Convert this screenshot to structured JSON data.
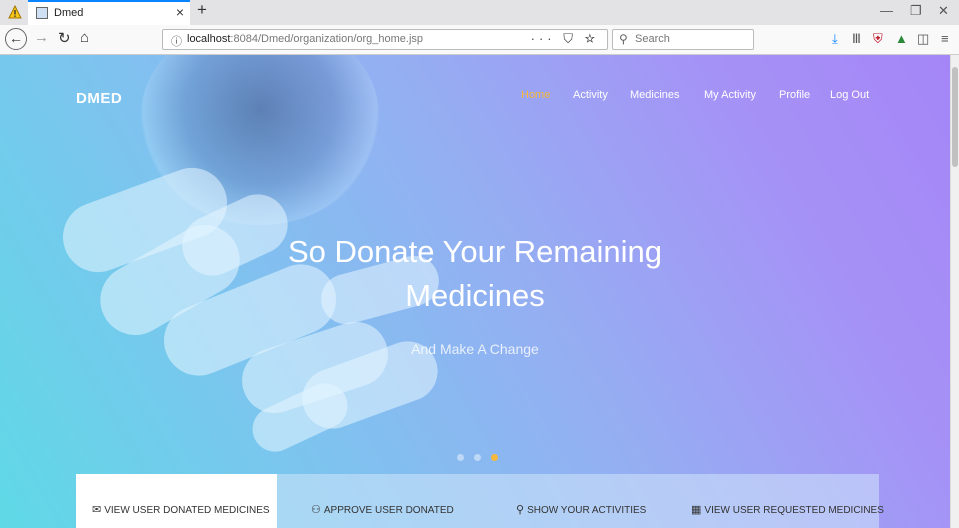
{
  "browser": {
    "tab_title": "Dmed",
    "url_prefix": "localhost",
    "url_rest": ":8084/Dmed/organization/org_home.jsp",
    "search_placeholder": "Search",
    "url_actions": "··· ⛉ ☆"
  },
  "site": {
    "logo": "DMED",
    "menu": [
      "Home",
      "Activity",
      "Medicines",
      "My Activity",
      "Profile",
      "Log Out"
    ],
    "active_menu": "Home",
    "hero_title_line1": "So Donate Your Remaining",
    "hero_title_line2": "Medicines",
    "hero_subtitle": "And Make A Change",
    "carousel_active_index": 2,
    "features": [
      {
        "label": "VIEW USER DONATED MEDICINES",
        "icon": "donate-icon"
      },
      {
        "label": "APPROVE USER DONATED",
        "icon": "approve-icon"
      },
      {
        "label": "SHOW YOUR ACTIVITIES",
        "icon": "activities-icon"
      },
      {
        "label": "VIEW USER REQUESTED MEDICINES",
        "icon": "request-icon"
      }
    ]
  },
  "colors": {
    "accent": "#f7b83b",
    "gradient_start": "#5fd9e6",
    "gradient_end": "#a586f7",
    "browser_accent": "#0a84ff"
  }
}
